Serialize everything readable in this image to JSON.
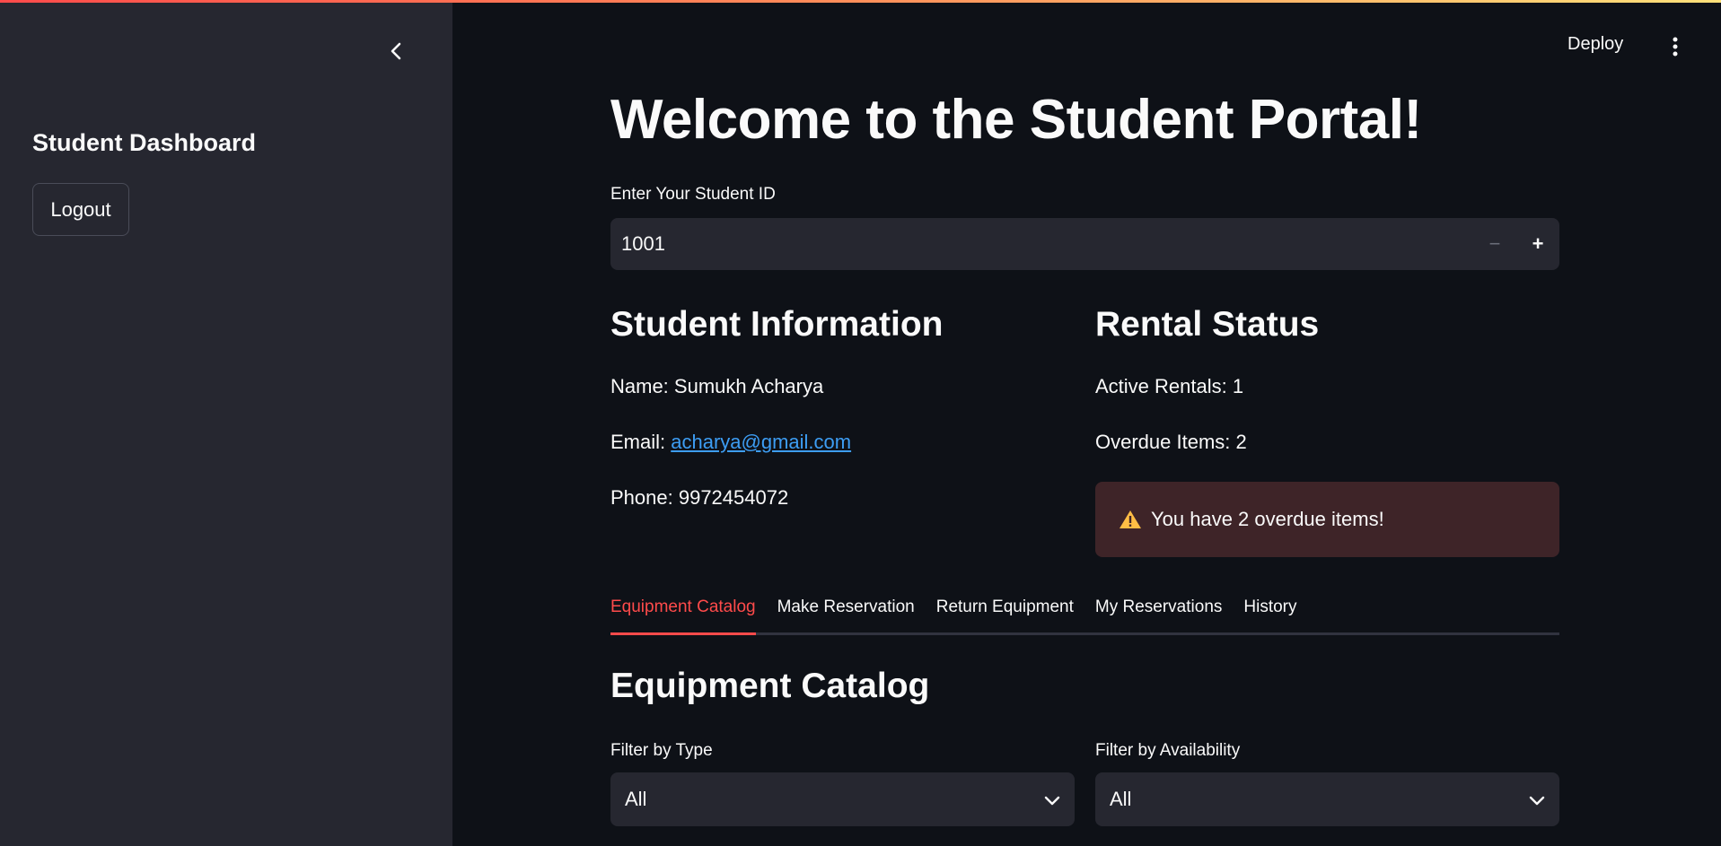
{
  "sidebar": {
    "title": "Student Dashboard",
    "logout_label": "Logout"
  },
  "header": {
    "deploy_label": "Deploy"
  },
  "main": {
    "page_title": "Welcome to the Student Portal!",
    "student_id": {
      "label": "Enter Your Student ID",
      "value": "1001",
      "minus": "−",
      "plus": "+"
    },
    "student_info": {
      "heading": "Student Information",
      "name_prefix": "Name: ",
      "name": "Sumukh Acharya",
      "email_prefix": "Email: ",
      "email": "acharya@gmail.com",
      "phone_prefix": "Phone: ",
      "phone": "9972454072"
    },
    "rental_status": {
      "heading": "Rental Status",
      "active_rentals": "Active Rentals: 1",
      "overdue_items": "Overdue Items: 2",
      "alert": "You have 2 overdue items!"
    },
    "tabs": [
      {
        "label": "Equipment Catalog",
        "active": true
      },
      {
        "label": "Make Reservation",
        "active": false
      },
      {
        "label": "Return Equipment",
        "active": false
      },
      {
        "label": "My Reservations",
        "active": false
      },
      {
        "label": "History",
        "active": false
      }
    ],
    "catalog": {
      "heading": "Equipment Catalog",
      "filter_type_label": "Filter by Type",
      "filter_type_value": "All",
      "filter_availability_label": "Filter by Availability",
      "filter_availability_value": "All"
    }
  },
  "colors": {
    "accent": "#ff4b4b",
    "link": "#3d9df3",
    "warning": "#ffbd45",
    "background": "#0e1117",
    "sidebar": "#262730"
  }
}
